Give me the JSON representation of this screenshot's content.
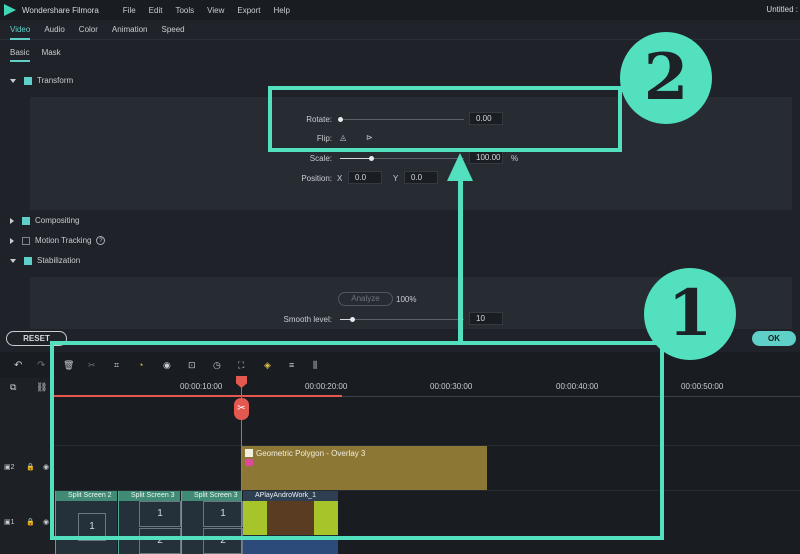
{
  "titlebar": {
    "app_title": "Wondershare Filmora",
    "menu": [
      "File",
      "Edit",
      "Tools",
      "View",
      "Export",
      "Help"
    ],
    "document_title": "Untitled :"
  },
  "tabs": [
    "Video",
    "Audio",
    "Color",
    "Animation",
    "Speed"
  ],
  "subtabs": [
    "Basic",
    "Mask"
  ],
  "sections": {
    "transform": "Transform",
    "compositing": "Compositing",
    "motion_tracking": "Motion Tracking",
    "stabilization": "Stabilization"
  },
  "transform": {
    "rotate_label": "Rotate:",
    "rotate_value": "0.00",
    "flip_label": "Flip:",
    "scale_label": "Scale:",
    "scale_value": "100.00",
    "scale_unit": "%",
    "position_label": "Position:",
    "x_label": "X",
    "x_value": "0.0",
    "y_label": "Y",
    "y_value": "0.0"
  },
  "stabilization": {
    "analyze_label": "Analyze",
    "analyze_percent": "100%",
    "smooth_label": "Smooth level:",
    "smooth_value": "10"
  },
  "buttons": {
    "reset": "RESET",
    "ok": "OK"
  },
  "timeline": {
    "time_labels": [
      "00:00:10:00",
      "00:00:20:00",
      "00:00:30:00",
      "00:00:40:00",
      "00:00:50:00"
    ],
    "overlay_clip": "Geometric Polygon - Overlay 3",
    "split_clips": [
      "Split Screen 2",
      "Split Screen 3",
      "Split Screen 3"
    ],
    "video_clip": "APlayAndroWork_1",
    "grid_numbers": [
      "1",
      "1",
      "1",
      "2",
      "2"
    ],
    "track_labels": [
      "2",
      "1"
    ]
  },
  "annotations": {
    "one": "1",
    "two": "2"
  },
  "colors": {
    "accent": "#5fd0c7",
    "annotation": "#53e0bf",
    "playhead": "#e5584f",
    "overlay_clip": "#8d7734"
  }
}
